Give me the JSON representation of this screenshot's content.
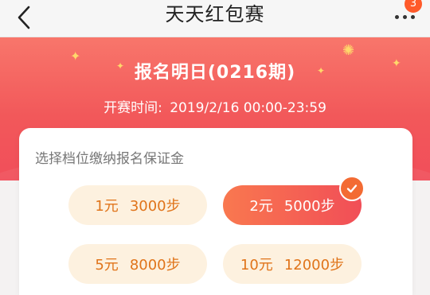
{
  "nav": {
    "title": "天天红包赛",
    "badge_count": "3"
  },
  "hero": {
    "title": "报名明日(0216期)",
    "time_label": "开赛时间:",
    "time_value": "2019/2/16 00:00-23:59"
  },
  "card": {
    "prompt": "选择档位缴纳报名保证金",
    "options": [
      {
        "amount": "1元",
        "steps": "3000步",
        "selected": false
      },
      {
        "amount": "2元",
        "steps": "5000步",
        "selected": true
      },
      {
        "amount": "5元",
        "steps": "8000步",
        "selected": false
      },
      {
        "amount": "10元",
        "steps": "12000步",
        "selected": false
      }
    ]
  },
  "colors": {
    "hero_top": "#f8766b",
    "hero_bottom": "#f14e5a",
    "option_bg": "#fdf1df",
    "option_text": "#e0741a",
    "selected_start": "#f9784f",
    "selected_end": "#f14e57",
    "badge": "#ff5a2a"
  },
  "icons": {
    "back": "chevron-left-icon",
    "more": "more-dots-icon",
    "check": "check-icon",
    "sparkle": "sparkle-icon"
  }
}
